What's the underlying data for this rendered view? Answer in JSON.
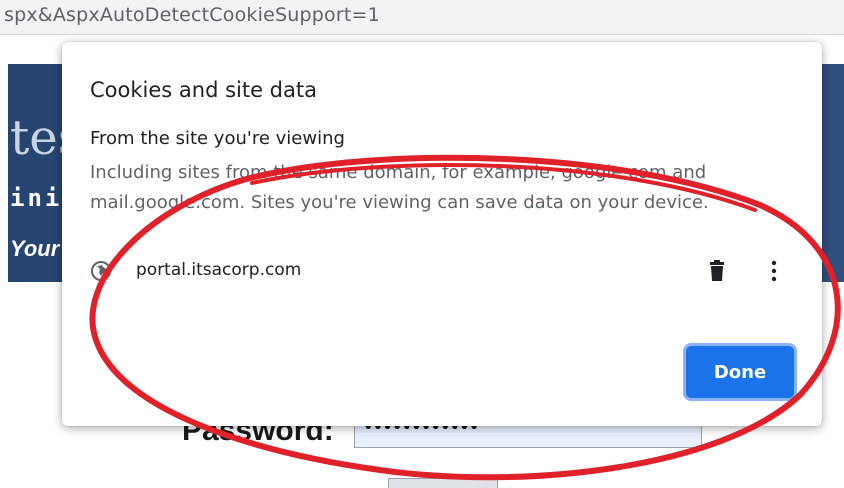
{
  "address_bar": {
    "url_fragment": "spx&AspxAutoDetectCookieSupport=1"
  },
  "background_page": {
    "banner_fragments": [
      "tes",
      "inis",
      "Your"
    ],
    "password_label": "Password:",
    "password_masked": "••••••••••••"
  },
  "cookies_dialog": {
    "title": "Cookies and site data",
    "section_title": "From the site you're viewing",
    "section_description": "Including sites from the same domain, for example, google.com and mail.google.com. Sites you're viewing can save data on your device.",
    "sites": [
      {
        "name": "portal.itsacorp.com",
        "icon": "globe-icon"
      }
    ],
    "actions": {
      "delete_icon": "trash-icon",
      "more_icon": "more-vert-icon"
    },
    "done_label": "Done",
    "accent_color": "#1a73e8"
  },
  "annotation": {
    "shape": "hand-drawn ellipse",
    "color": "#e0212a"
  }
}
